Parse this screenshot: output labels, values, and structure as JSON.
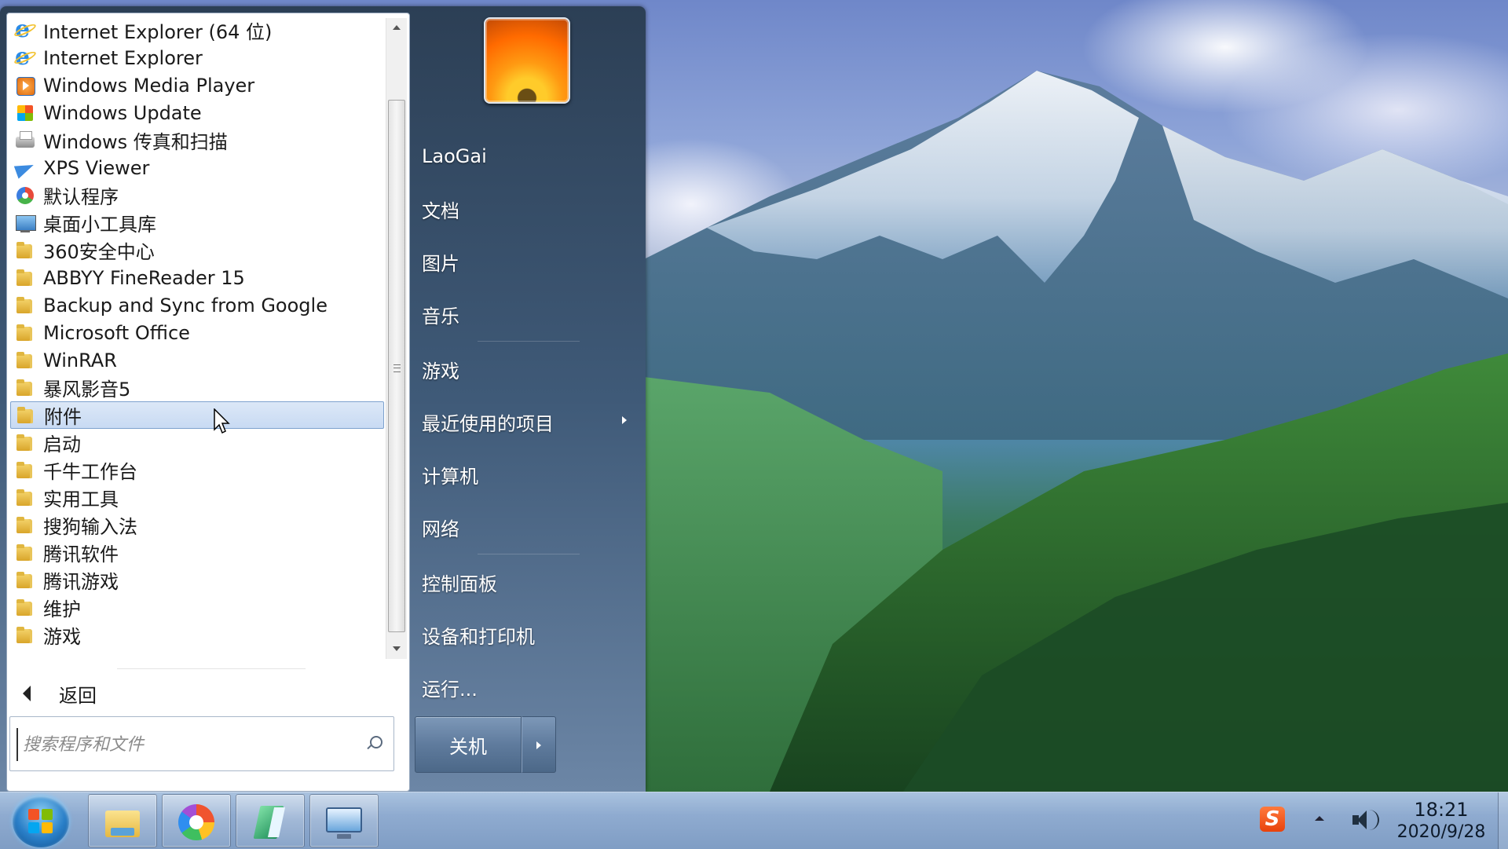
{
  "start_menu": {
    "programs": [
      {
        "label": "Internet Explorer (64 位)",
        "icon": "ie-icon"
      },
      {
        "label": "Internet Explorer",
        "icon": "ie-icon"
      },
      {
        "label": "Windows Media Player",
        "icon": "wmp-icon"
      },
      {
        "label": "Windows Update",
        "icon": "wu-icon"
      },
      {
        "label": "Windows 传真和扫描",
        "icon": "fax-icon"
      },
      {
        "label": "XPS Viewer",
        "icon": "xps-icon"
      },
      {
        "label": "默认程序",
        "icon": "def-icon"
      },
      {
        "label": "桌面小工具库",
        "icon": "gadget-icon"
      },
      {
        "label": "360安全中心",
        "icon": "folder-icon"
      },
      {
        "label": "ABBYY FineReader 15",
        "icon": "folder-icon"
      },
      {
        "label": "Backup and Sync from Google",
        "icon": "folder-icon"
      },
      {
        "label": "Microsoft Office",
        "icon": "folder-icon"
      },
      {
        "label": "WinRAR",
        "icon": "folder-icon"
      },
      {
        "label": "暴风影音5",
        "icon": "folder-icon"
      },
      {
        "label": "附件",
        "icon": "folder-icon",
        "selected": true
      },
      {
        "label": "启动",
        "icon": "folder-icon"
      },
      {
        "label": "千牛工作台",
        "icon": "folder-icon"
      },
      {
        "label": "实用工具",
        "icon": "folder-icon"
      },
      {
        "label": "搜狗输入法",
        "icon": "folder-icon"
      },
      {
        "label": "腾讯软件",
        "icon": "folder-icon"
      },
      {
        "label": "腾讯游戏",
        "icon": "folder-icon"
      },
      {
        "label": "维护",
        "icon": "folder-icon"
      },
      {
        "label": "游戏",
        "icon": "folder-icon"
      }
    ],
    "back_label": "返回",
    "search_placeholder": "搜索程序和文件",
    "right": {
      "user": "LaoGai",
      "documents": "文档",
      "pictures": "图片",
      "music": "音乐",
      "games": "游戏",
      "recent": "最近使用的项目",
      "computer": "计算机",
      "network": "网络",
      "control_panel": "控制面板",
      "devices": "设备和打印机",
      "run": "运行..."
    },
    "shutdown_label": "关机"
  },
  "taskbar": {
    "apps": [
      "explorer-icon",
      "browser-icon",
      "notebook-icon",
      "remote-icon"
    ],
    "tray": {
      "ime_icon_text": "S",
      "time": "18:21",
      "date": "2020/9/28"
    }
  },
  "colors": {
    "menu_accent": "#3f5a78",
    "selection": "#c8daf3",
    "taskbar": "#8fabd0"
  }
}
